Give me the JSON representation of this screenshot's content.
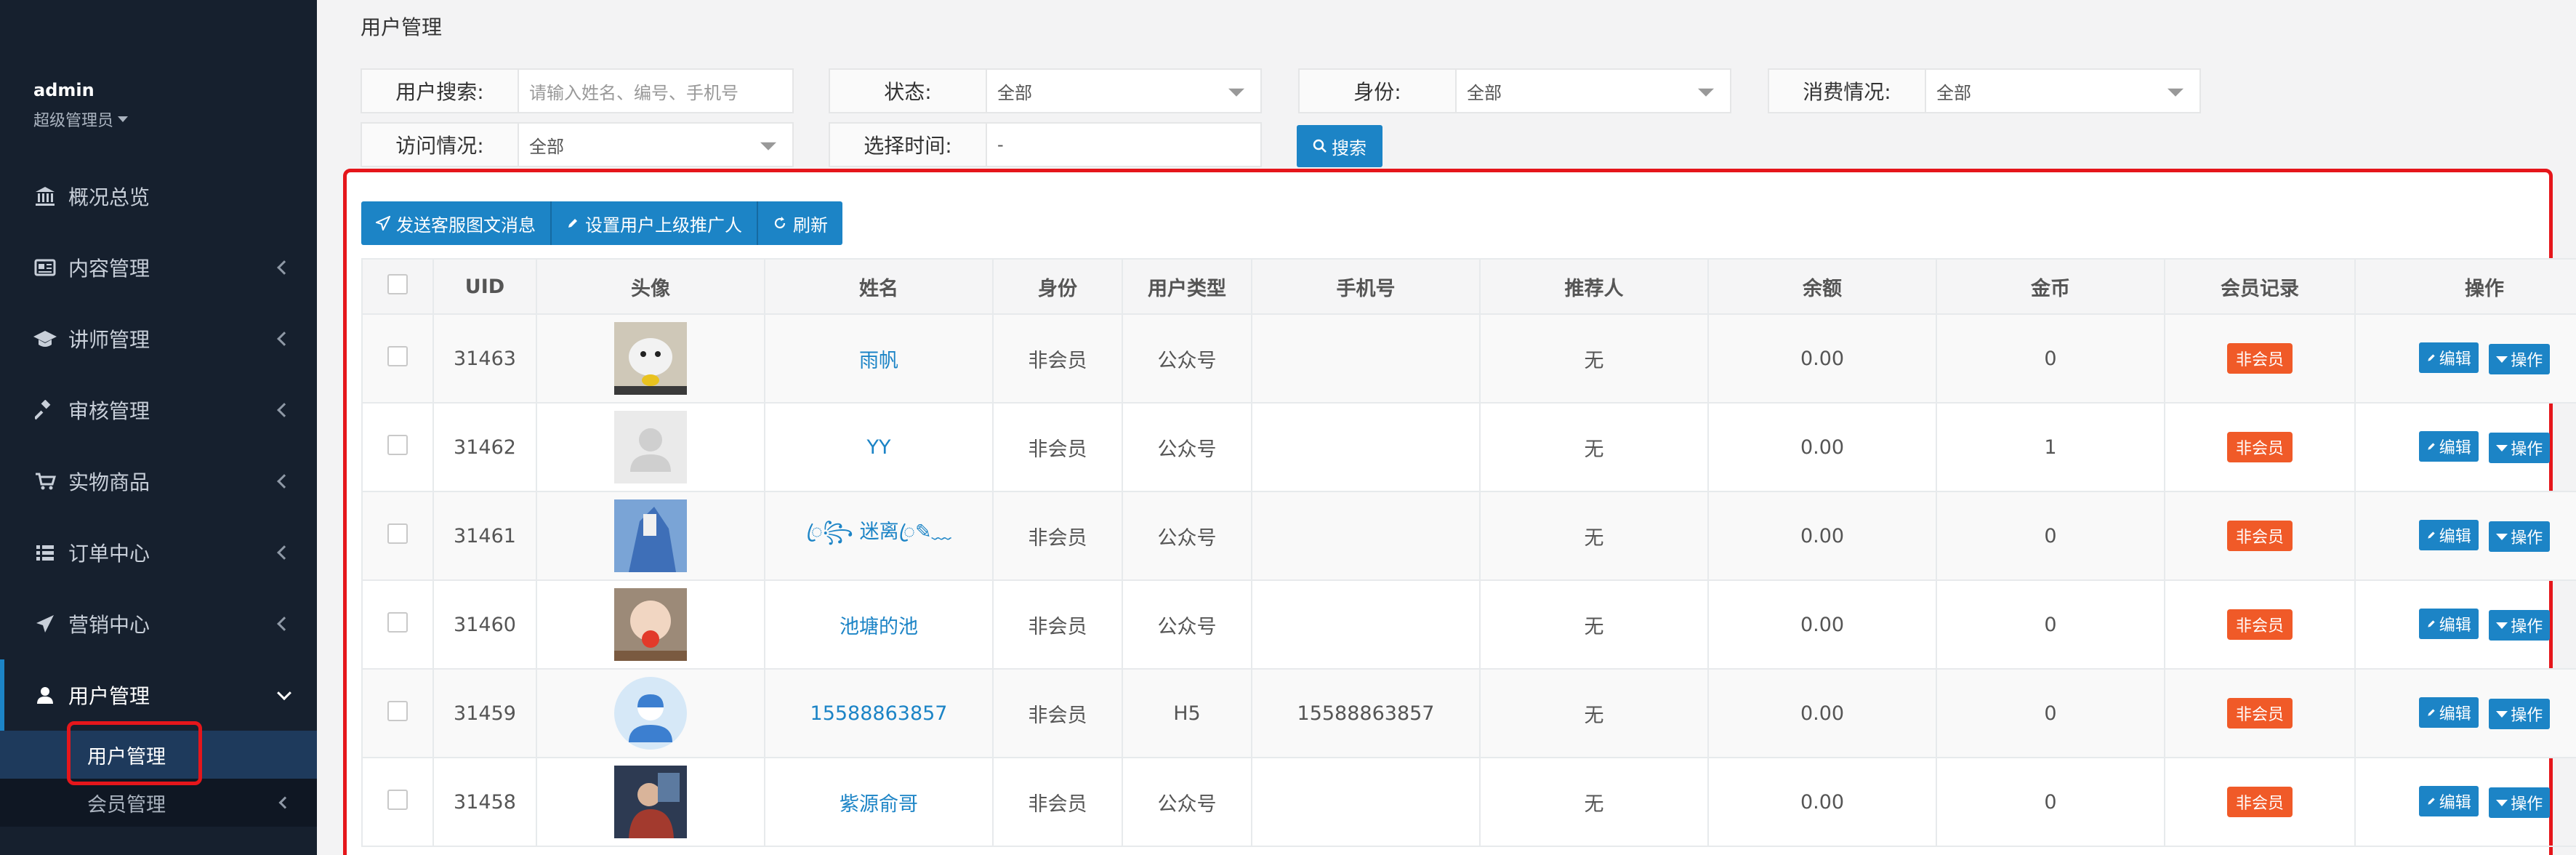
{
  "sidebar": {
    "username": "admin",
    "role": "超级管理员",
    "items": [
      {
        "label": "概况总览",
        "icon": "bank-icon"
      },
      {
        "label": "内容管理",
        "icon": "newspaper-icon"
      },
      {
        "label": "讲师管理",
        "icon": "graduation-cap-icon"
      },
      {
        "label": "审核管理",
        "icon": "gavel-icon"
      },
      {
        "label": "实物商品",
        "icon": "cart-icon"
      },
      {
        "label": "订单中心",
        "icon": "list-icon"
      },
      {
        "label": "营销中心",
        "icon": "paper-plane-icon"
      },
      {
        "label": "用户管理",
        "icon": "user-icon"
      }
    ],
    "sub_items": [
      {
        "label": "用户管理"
      },
      {
        "label": "会员管理"
      }
    ]
  },
  "page_title": "用户管理",
  "filters": {
    "user_search": {
      "label": "用户搜索:",
      "placeholder": "请输入姓名、编号、手机号"
    },
    "status": {
      "label": "状态:",
      "value": "全部"
    },
    "identity": {
      "label": "身份:",
      "value": "全部"
    },
    "consumption": {
      "label": "消费情况:",
      "value": "全部"
    },
    "visit": {
      "label": "访问情况:",
      "value": "全部"
    },
    "time": {
      "label": "选择时间:",
      "value": "-"
    },
    "search_button": "搜索"
  },
  "toolbar": {
    "send_msg": "发送客服图文消息",
    "set_promoter": "设置用户上级推广人",
    "refresh": "刷新"
  },
  "table": {
    "headers": [
      "UID",
      "头像",
      "姓名",
      "身份",
      "用户类型",
      "手机号",
      "推荐人",
      "余额",
      "金币",
      "会员记录",
      "操作"
    ],
    "rows": [
      {
        "uid": "31463",
        "name": "雨帆",
        "identity": "非会员",
        "type": "公众号",
        "phone": "",
        "referrer": "无",
        "balance": "0.00",
        "coins": "0",
        "member": "非会员"
      },
      {
        "uid": "31462",
        "name": "YY",
        "identity": "非会员",
        "type": "公众号",
        "phone": "",
        "referrer": "无",
        "balance": "0.00",
        "coins": "1",
        "member": "非会员"
      },
      {
        "uid": "31461",
        "name": "ꦿ꧂ 迷离ꦿ✎﹏",
        "identity": "非会员",
        "type": "公众号",
        "phone": "",
        "referrer": "无",
        "balance": "0.00",
        "coins": "0",
        "member": "非会员"
      },
      {
        "uid": "31460",
        "name": "池塘的池",
        "identity": "非会员",
        "type": "公众号",
        "phone": "",
        "referrer": "无",
        "balance": "0.00",
        "coins": "0",
        "member": "非会员"
      },
      {
        "uid": "31459",
        "name": "15588863857",
        "identity": "非会员",
        "type": "H5",
        "phone": "15588863857",
        "referrer": "无",
        "balance": "0.00",
        "coins": "0",
        "member": "非会员"
      },
      {
        "uid": "31458",
        "name": "紫源俞哥",
        "identity": "非会员",
        "type": "公众号",
        "phone": "",
        "referrer": "无",
        "balance": "0.00",
        "coins": "0",
        "member": "非会员"
      }
    ],
    "edit_label": "编辑",
    "action_label": "操作"
  }
}
